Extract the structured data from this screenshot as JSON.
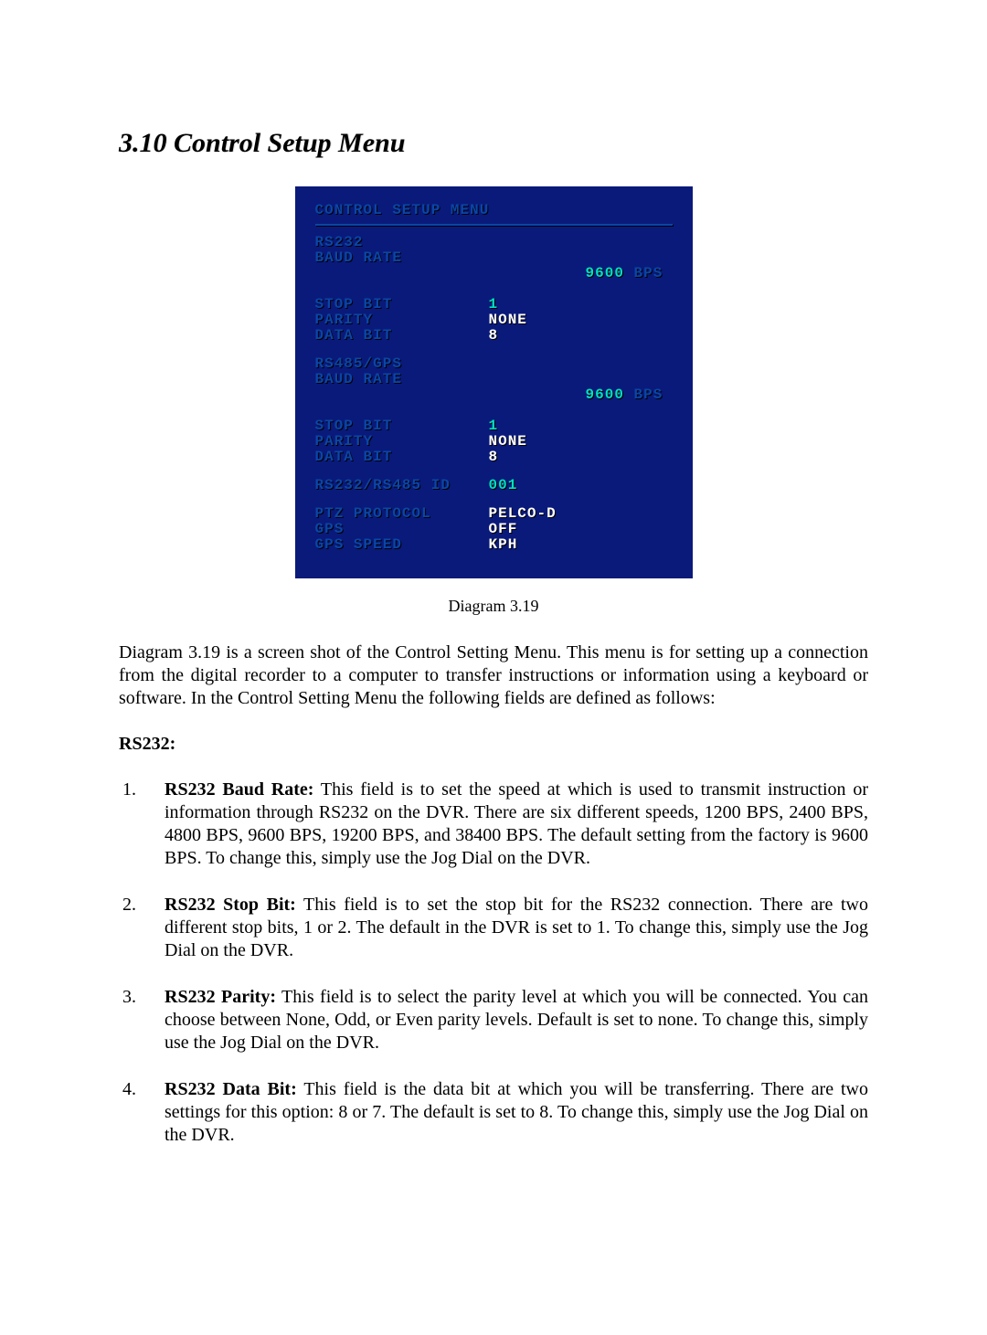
{
  "heading": "3.10 Control Setup Menu",
  "osd": {
    "title": "CONTROL SETUP MENU",
    "group1_head": "RS232",
    "group1": {
      "baud_label": "BAUD RATE",
      "baud_value": "9600",
      "baud_unit": " BPS",
      "stop_label": "STOP BIT",
      "stop_value": "1",
      "parity_label": "PARITY",
      "parity_value": "NONE",
      "data_label": "DATA BIT",
      "data_value": "8"
    },
    "group2_head": "RS485/GPS",
    "group2": {
      "baud_label": "BAUD RATE",
      "baud_value": "9600",
      "baud_unit": " BPS",
      "stop_label": "STOP BIT",
      "stop_value": "1",
      "parity_label": "PARITY",
      "parity_value": "NONE",
      "data_label": "DATA BIT",
      "data_value": "8"
    },
    "id_label": "RS232/RS485 ID",
    "id_value": "001",
    "ptz_label": "PTZ PROTOCOL",
    "ptz_value": "PELCO-D",
    "gps_label": "GPS",
    "gps_value": "OFF",
    "gpss_label": "GPS SPEED",
    "gpss_value": "KPH"
  },
  "caption": "Diagram 3.19",
  "intro": "Diagram 3.19 is a screen shot of the Control Setting Menu. This menu is for setting up a connection from the digital recorder to a computer to transfer instructions or information using a keyboard or software. In the Control Setting Menu the following fields are defined as follows:",
  "subhead": "RS232:",
  "fields": [
    {
      "name": "RS232 Baud Rate:",
      "desc": " This field is to set the speed at which is used to transmit instruction or information through RS232 on the DVR. There are six different speeds, 1200 BPS, 2400 BPS, 4800 BPS, 9600 BPS, 19200 BPS, and 38400 BPS. The default setting from the factory is 9600 BPS. To change this, simply use the Jog Dial on the DVR."
    },
    {
      "name": "RS232 Stop Bit:",
      "desc": " This field is to set the stop bit for the RS232 connection. There are two different stop bits, 1 or 2. The default in the DVR is set to 1. To change this, simply use the Jog Dial on the DVR."
    },
    {
      "name": "RS232 Parity:",
      "desc": " This field is to select the parity level at which you will be connected. You can choose between None, Odd, or Even parity levels. Default is set to none. To change this, simply use the Jog Dial on the DVR."
    },
    {
      "name": "RS232 Data Bit:",
      "desc": " This field is the data bit at which you will be transferring. There are two settings for this option: 8 or 7. The default is set to 8. To change this, simply use the Jog Dial on the DVR."
    }
  ]
}
